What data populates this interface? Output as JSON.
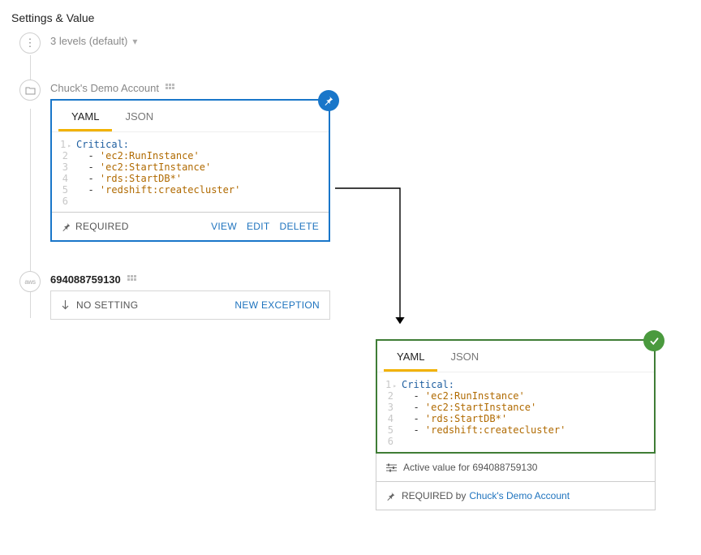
{
  "header": {
    "title": "Settings & Value"
  },
  "levels": {
    "label": "3 levels (default)"
  },
  "org": {
    "label": "Chuck's Demo Account",
    "card": {
      "tabs": {
        "yaml": "YAML",
        "json": "JSON"
      },
      "code": {
        "key": "Critical:",
        "items": [
          "'ec2:RunInstance'",
          "'ec2:StartInstance'",
          "'rds:StartDB*'",
          "'redshift:createcluster'"
        ]
      },
      "footer": {
        "required": "REQUIRED",
        "view": "VIEW",
        "edit": "EDIT",
        "delete": "DELETE"
      }
    }
  },
  "account": {
    "label": "694088759130",
    "no_setting": "NO SETTING",
    "new_exception": "NEW EXCEPTION"
  },
  "resolved": {
    "tabs": {
      "yaml": "YAML",
      "json": "JSON"
    },
    "code": {
      "key": "Critical:",
      "items": [
        "'ec2:RunInstance'",
        "'ec2:StartInstance'",
        "'rds:StartDB*'",
        "'redshift:createcluster'"
      ]
    },
    "active_label": "Active value for 694088759130",
    "required_by": "REQUIRED by",
    "source": "Chuck's Demo Account"
  }
}
